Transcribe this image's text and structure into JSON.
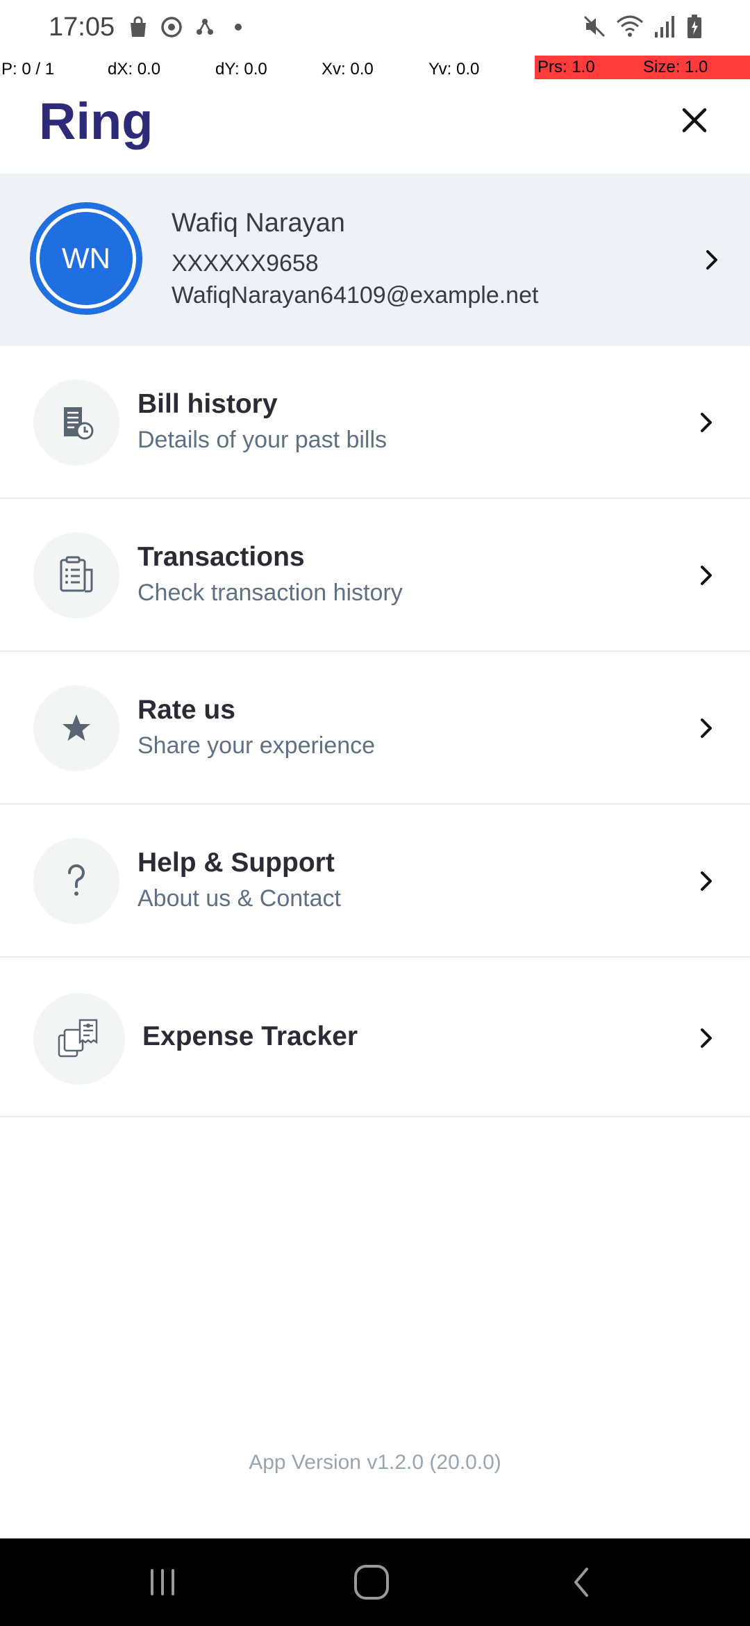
{
  "status_bar": {
    "time": "17:05"
  },
  "debug_overlay": {
    "pointer": "P: 0 / 1",
    "dx": "dX: 0.0",
    "dy": "dY: 0.0",
    "xv": "Xv: 0.0",
    "yv": "Yv: 0.0",
    "prs": "Prs: 1.0",
    "size": "Size: 1.0"
  },
  "header": {
    "logo_text": "Ring"
  },
  "profile": {
    "initials": "WN",
    "name": "Wafiq Narayan",
    "phone": "XXXXXX9658",
    "email": "WafiqNarayan64109@example.net"
  },
  "menu": {
    "bill_history": {
      "title": "Bill history",
      "subtitle": "Details of your past bills"
    },
    "transactions": {
      "title": "Transactions",
      "subtitle": "Check transaction history"
    },
    "rate_us": {
      "title": "Rate us",
      "subtitle": "Share your experience"
    },
    "help_support": {
      "title": "Help & Support",
      "subtitle": "About us & Contact"
    },
    "expense_tracker": {
      "title": "Expense Tracker"
    }
  },
  "footer": {
    "app_version": "App Version v1.2.0 (20.0.0)"
  },
  "colors": {
    "brand": "#2d2a7a",
    "avatar_blue": "#1f6fe0",
    "profile_bg": "#eef2f6",
    "subtitle_gray": "#5f7084",
    "debug_red": "#ff3b3b"
  },
  "icons": {
    "close": "close-icon",
    "chevron": "chevron-right-icon",
    "bill_history": "bill-history-icon",
    "transactions": "transactions-icon",
    "rate_us": "star-icon",
    "help": "question-mark-icon",
    "expense_tracker": "expense-tracker-icon"
  }
}
